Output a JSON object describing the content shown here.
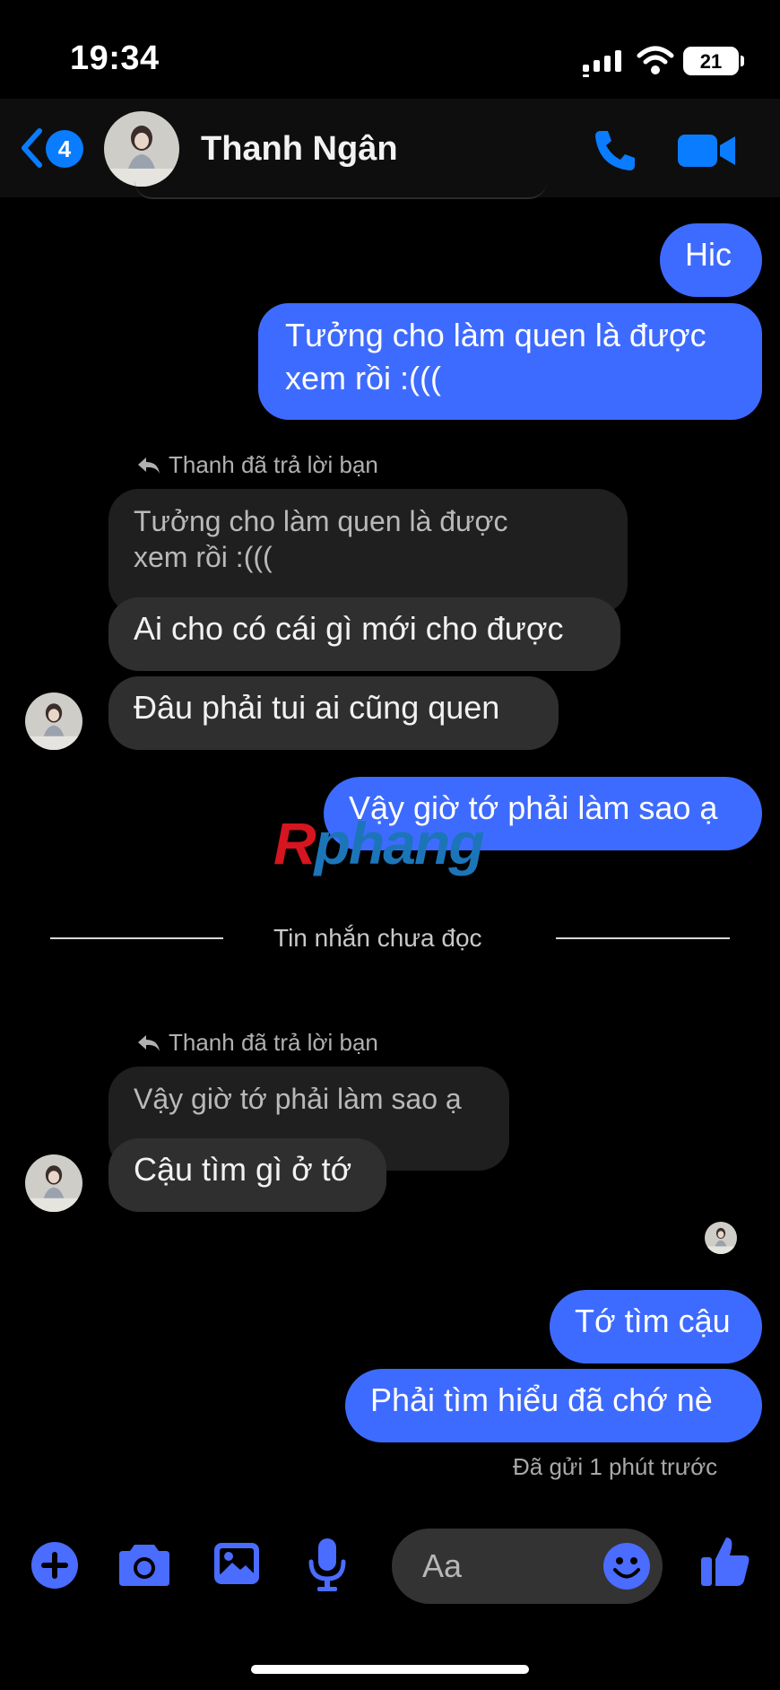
{
  "status_bar": {
    "time": "19:34",
    "battery": "21"
  },
  "header": {
    "back_badge": "4",
    "contact_name": "Thanh Ngân"
  },
  "messages": {
    "m1": "Hic",
    "m2_line1": "Tưởng cho làm quen là được",
    "m2_line2": "xem rồi :(((",
    "reply1_label": "Thanh đã trả lời bạn",
    "reply1_quote_line1": "Tưởng cho làm quen là được",
    "reply1_quote_line2": "xem rồi :(((",
    "m3": "Ai cho có cái gì mới cho được",
    "m4": "Đâu phải tui ai cũng quen",
    "m5": "Vậy giờ tớ phải làm sao ạ",
    "unread_divider": "Tin nhắn chưa đọc",
    "reply2_label": "Thanh đã trả lời bạn",
    "reply2_quote": "Vậy giờ tớ phải làm sao ạ",
    "m6": "Cậu tìm gì ở tớ",
    "m7": "Tớ tìm cậu",
    "m8": "Phải tìm hiểu đã chớ nè",
    "sent_status": "Đã gửi 1 phút trước"
  },
  "watermark": {
    "first": "R",
    "rest": "phang"
  },
  "composer": {
    "placeholder": "Aa"
  },
  "colors": {
    "outgoing": "#3e6bff",
    "incoming": "#2f2f2f",
    "accent": "#0a7cff",
    "icon": "#4a6cff"
  },
  "icons": [
    "back-chevron-icon",
    "phone-icon",
    "video-camera-icon",
    "reply-arrow-icon",
    "plus-icon",
    "camera-icon",
    "image-icon",
    "microphone-icon",
    "emoji-icon",
    "like-thumb-icon"
  ]
}
